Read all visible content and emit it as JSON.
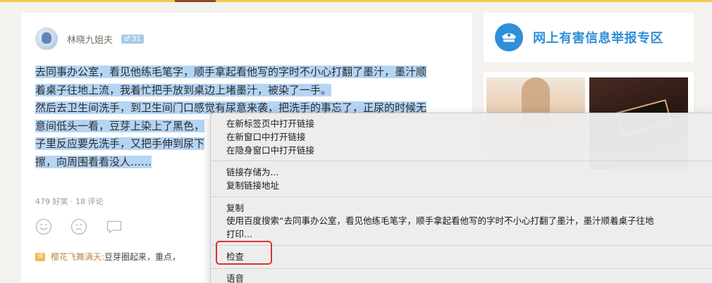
{
  "post": {
    "author": "林晓九姐夫",
    "level": "31",
    "paragraph_lines": [
      "去同事办公室，看见他练毛笔字，顺手拿起看他写的字时不小心打翻了墨汁，墨汁顺",
      "着桌子往地上流，我着忙把手放到桌边上堵墨汁，被染了一手。",
      "然后去卫生间洗手，到卫生间门口感觉有尿意来袭，把洗手的事忘了，正尿的时候无",
      "意间低头一看，豆芽上染上了黑色，",
      "子里反应要先洗手，又把手伸到尿下",
      "擦，向周围看看没人……"
    ],
    "stats": "479 好笑 · 18 评论",
    "comment": {
      "icon": "评",
      "user": "樱花飞舞满天:",
      "text": " 豆芽圈起来，重点，"
    }
  },
  "sidebar": {
    "report_label": "网上有害信息举报专区"
  },
  "context_menu": {
    "items": [
      "在新标签页中打开链接",
      "在新窗口中打开链接",
      "在隐身窗口中打开链接",
      "链接存储为...",
      "复制链接地址",
      "复制",
      "使用百度搜索“去同事办公室，看见他练毛笔字，顺手拿起看他写的字时不小心打翻了墨汁，墨汁顺着桌子往地",
      "打印...",
      "检查",
      "语音"
    ]
  },
  "colors": {
    "selection": "#b5d5f5",
    "accent": "#2f8fd8",
    "highlight_box": "#e03030"
  }
}
